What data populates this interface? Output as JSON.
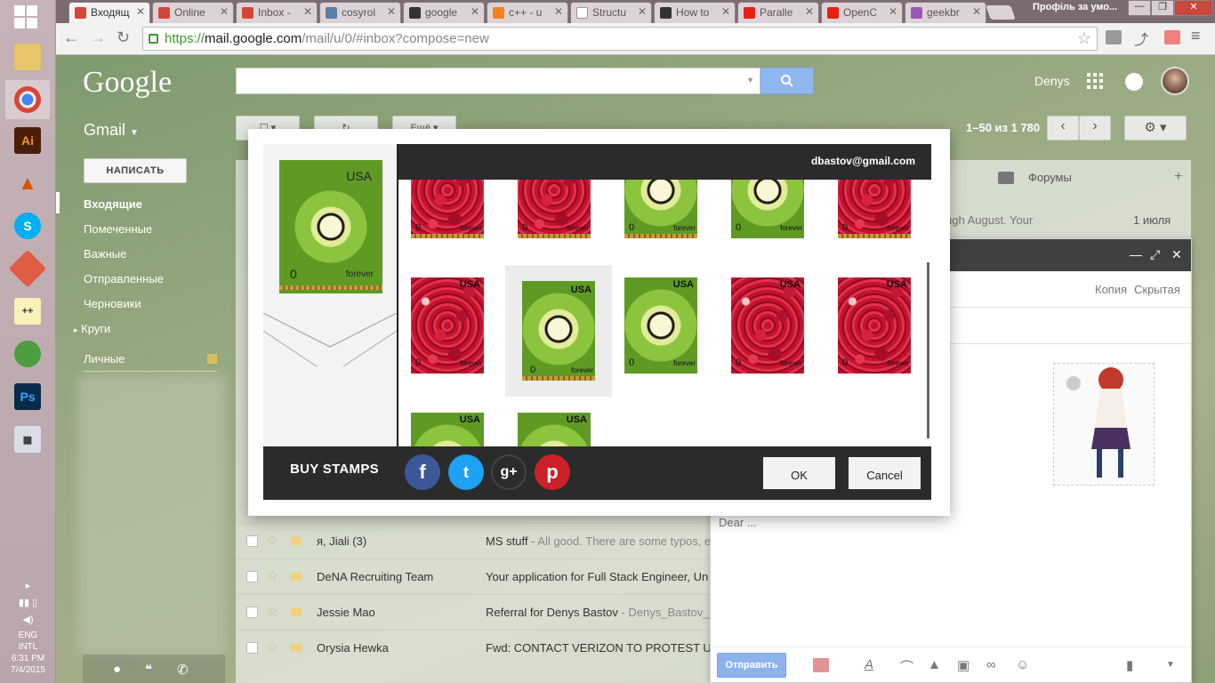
{
  "taskbar": {
    "tray": {
      "lang": "ENG",
      "layout": "INTL",
      "time": "6:31 PM",
      "date": "7/4/2015"
    }
  },
  "browser": {
    "tabs": [
      {
        "label": "Входящ",
        "fav": "#d44638"
      },
      {
        "label": "Online",
        "fav": "#d44638"
      },
      {
        "label": "Inbox -",
        "fav": "#d44638"
      },
      {
        "label": "cosyrol",
        "fav": "#5b7fa6"
      },
      {
        "label": "google",
        "fav": "#333333"
      },
      {
        "label": "c++ - u",
        "fav": "#f48024"
      },
      {
        "label": "Structu",
        "fav": "#ffffff"
      },
      {
        "label": "How to",
        "fav": "#333333"
      },
      {
        "label": "Paralle",
        "fav": "#e62117"
      },
      {
        "label": "OpenC",
        "fav": "#e62117"
      },
      {
        "label": "geekbr",
        "fav": "#9b59b6"
      }
    ],
    "profile": "Профіль за умо...",
    "url": {
      "scheme": "https://",
      "host": "mail.google.com",
      "path": "/mail/u/0/#inbox?compose=new"
    }
  },
  "gmail": {
    "logo": "Google",
    "user": "Denys",
    "app_label": "Gmail",
    "compose_label": "НАПИСАТЬ",
    "more_label": "Ещё",
    "pager": "1–50 из 1 780",
    "nav": [
      "Входящие",
      "Помеченные",
      "Важные",
      "Отправленные",
      "Черновики",
      "Круги",
      "Личные"
    ],
    "tab_forums": "Форумы",
    "snippet_top": "ugh August. Your",
    "date_top": "1 июля",
    "rows": [
      {
        "sender": "я, Jiali (3)",
        "subject": "MS stuff",
        "snippet": " - All good. There are some typos, e"
      },
      {
        "sender": "DeNA Recruiting Team",
        "subject": "Your application for Full Stack Engineer, Un",
        "snippet": ""
      },
      {
        "sender": "Jessie Mao",
        "subject": "Referral for Denys Bastov",
        "snippet": " - Denys_Bastov_R"
      },
      {
        "sender": "Orysia Hewka",
        "subject": "Fwd: CONTACT VERIZON TO PROTEST U",
        "snippet": ""
      }
    ]
  },
  "compose": {
    "cc": "Копия",
    "bcc": "Скрытая",
    "body": "Dear ...",
    "send": "Отправить"
  },
  "stamp_dialog": {
    "email": "dbastov@gmail.com",
    "buy": "BUY STAMPS",
    "ok": "OK",
    "cancel": "Cancel",
    "stamp_country": "USA",
    "stamp_value": "0",
    "stamp_word": "forever",
    "social": [
      "f",
      "t",
      "g+",
      "p"
    ]
  }
}
